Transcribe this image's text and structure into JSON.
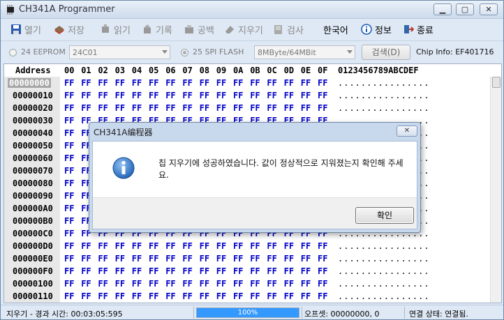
{
  "window": {
    "title": "CH341A Programmer",
    "min_label": "▁",
    "max_label": "▢",
    "close_label": "✕"
  },
  "toolbar": {
    "open": "열기",
    "save": "저장",
    "read": "읽기",
    "write": "기록",
    "blank": "공백",
    "erase": "지우기",
    "verify": "검사",
    "language": "한국어",
    "info": "정보",
    "exit": "종료"
  },
  "options": {
    "eeprom_label": "24 EEPROM",
    "eeprom_value": "24C01",
    "spi_label": "25 SPI FLASH",
    "spi_value": "8MByte/64MBit",
    "search_label": "검색(D)",
    "chip_info": "Chip Info: EF401716"
  },
  "hex": {
    "address_header": "Address",
    "columns": [
      "00",
      "01",
      "02",
      "03",
      "04",
      "05",
      "06",
      "07",
      "08",
      "09",
      "0A",
      "0B",
      "0C",
      "0D",
      "0E",
      "0F"
    ],
    "ascii_header": "0123456789ABCDEF",
    "rows": [
      "00000000",
      "00000010",
      "00000020",
      "00000030",
      "00000040",
      "00000050",
      "00000060",
      "00000070",
      "00000080",
      "00000090",
      "000000A0",
      "000000B0",
      "000000C0",
      "000000D0",
      "000000E0",
      "000000F0",
      "00000100",
      "00000110"
    ],
    "byte_value": "FF",
    "ascii_value": "................"
  },
  "status": {
    "elapsed": "지우기 - 경과 시간: 00:03:05:595",
    "progress_text": "100%",
    "progress": 1.0,
    "offset": "오프셋: 00000000, 0",
    "connection": "연결 상태: 연결됨."
  },
  "dialog": {
    "title": "CH341A编程器",
    "message": "칩 지우기에 성공하였습니다. 값이 정상적으로 지워졌는지 확인해 주세요.",
    "ok_label": "확인",
    "close_label": "✕"
  },
  "colors": {
    "byte_color": "#0000c8",
    "progress_fill": "#3399ff",
    "frame": "#dfe9f5"
  }
}
